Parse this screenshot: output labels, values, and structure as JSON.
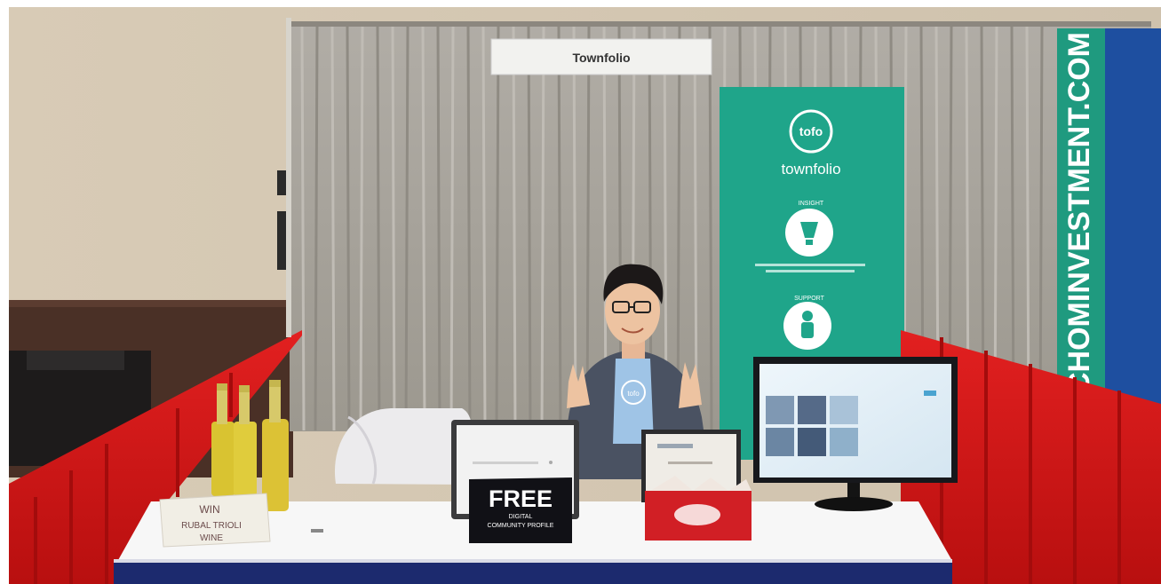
{
  "booth_sign": {
    "text": "Townfolio"
  },
  "banner": {
    "logo_mark": "tofo",
    "brand": "townfolio",
    "section1_heading": "INSIGHT",
    "section2_heading": "SUPPORT",
    "color": "#1fa58a"
  },
  "right_banner": {
    "text": "CHOMINVESTMENT.COM",
    "color": "#1e4fa0"
  },
  "free_sign": {
    "headline": "FREE",
    "line1": "DIGITAL",
    "line2": "COMMUNITY PROFILE"
  },
  "wine_card": {
    "line1": "WIN",
    "line2": "RUBAL TRIOLI",
    "line3": "WINE"
  },
  "shirt_logo": "tofo",
  "colors": {
    "drape": "#d81818",
    "table_cloth": "#f7f7f7",
    "skirt": "#1c2a6e",
    "curtain": "#a8a49c"
  }
}
